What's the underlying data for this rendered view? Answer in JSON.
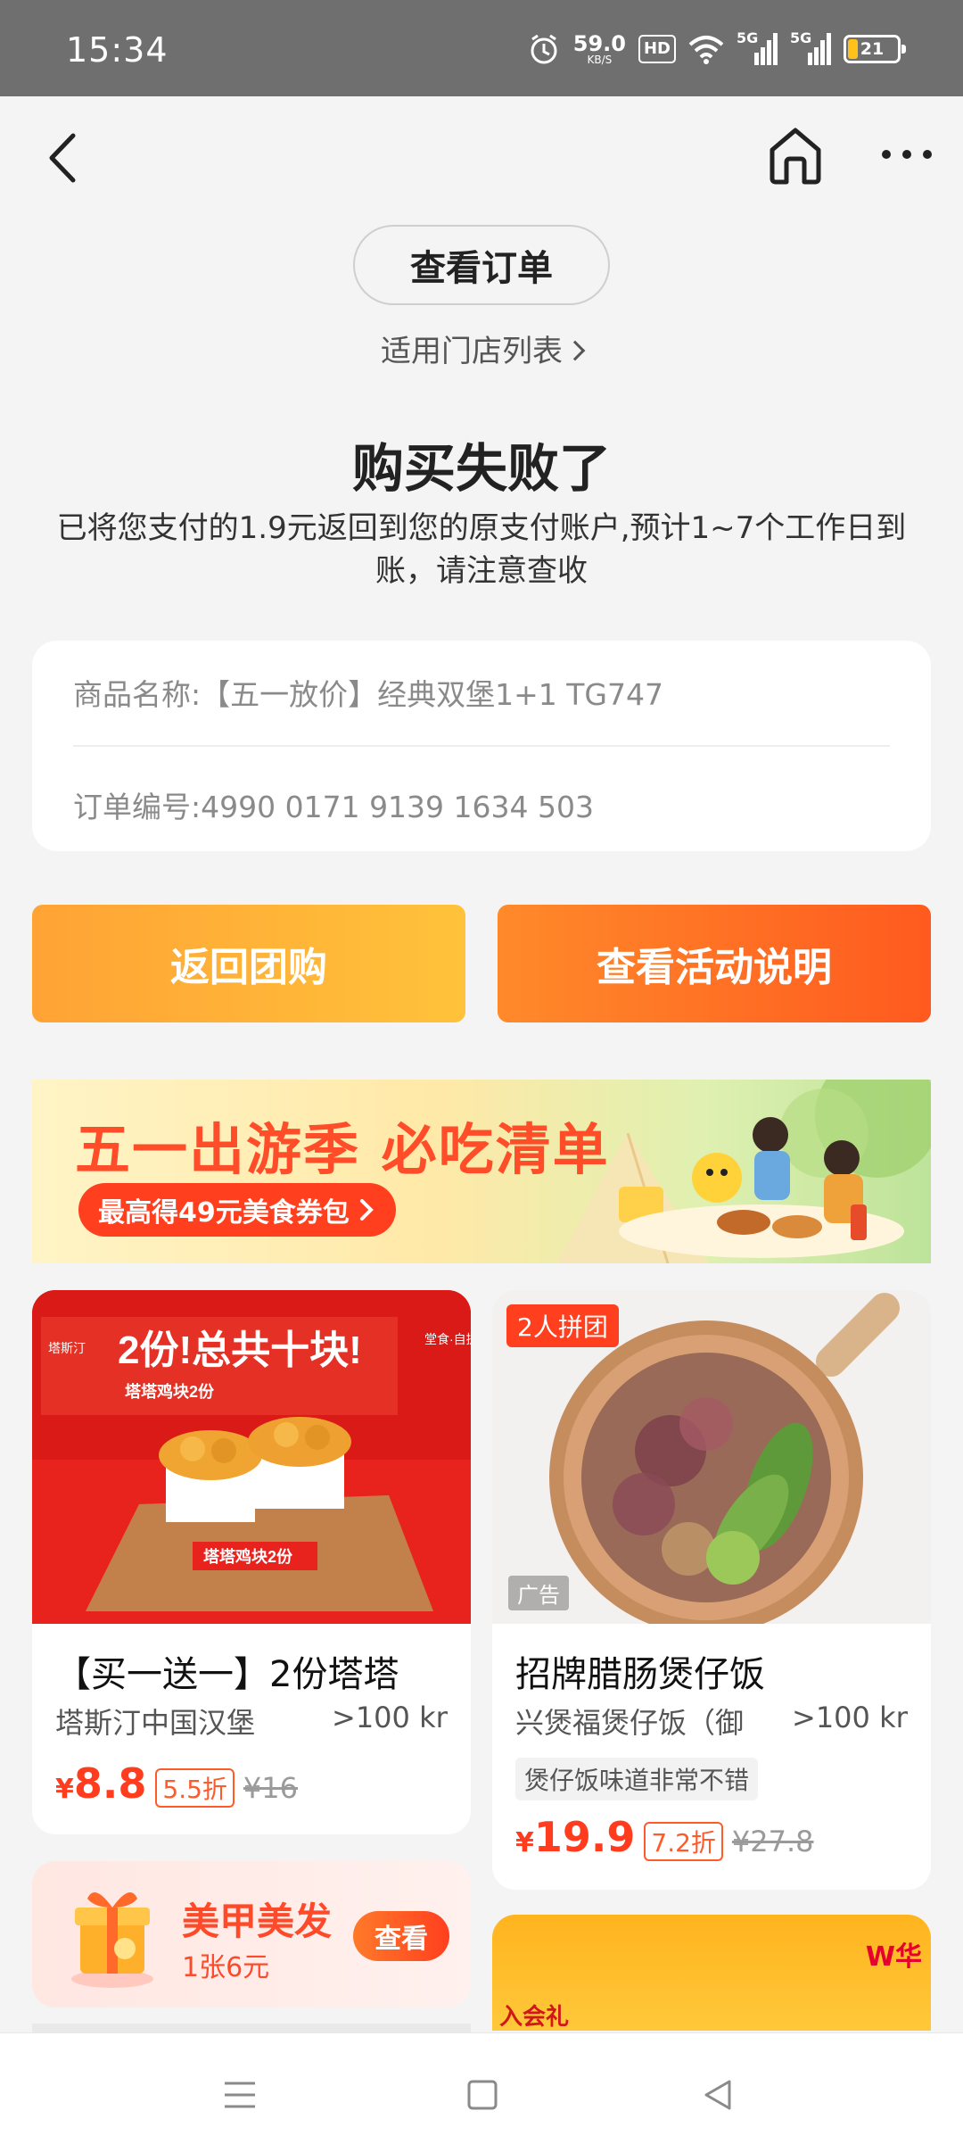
{
  "status_bar": {
    "time": "15:34",
    "net_speed_value": "59.0",
    "net_speed_unit": "KB/S",
    "hd_label": "HD",
    "signal_1_label": "5G",
    "signal_2_label": "5G",
    "battery_level": "21",
    "battery_fraction": 0.21,
    "icons": [
      "alarm-icon",
      "hd-icon",
      "wifi-icon",
      "signal-icon",
      "signal-icon",
      "battery-icon"
    ]
  },
  "nav": {
    "icons": [
      "back-icon",
      "home-icon",
      "more-icon"
    ]
  },
  "actions": {
    "view_order": "查看订单",
    "store_list": "适用门店列表"
  },
  "result": {
    "title": "购买失败了",
    "description": "已将您支付的1.9元返回到您的原支付账户,预计1~7个工作日到账，请注意查收"
  },
  "order_info": {
    "product_name": "商品名称:【五一放价】经典双堡1+1 TG747",
    "order_number": "订单编号:4990 0171 9139 1634 503"
  },
  "buttons": {
    "back_to_group": "返回团购",
    "view_activity": "查看活动说明"
  },
  "banner": {
    "title": "五一出游季 必吃清单",
    "cta": "最高得49元美食券包",
    "colors": {
      "title": "#ff4d2a",
      "pill": "#ff3f1e"
    }
  },
  "products": [
    {
      "name": "【买一送一】2份塔塔",
      "shop": "塔斯汀中国汉堡",
      "distance": ">100 km",
      "price_symbol": "¥",
      "price": "8.8",
      "discount": "5.5折",
      "original_price": "¥16",
      "image_texts": {
        "headline": "2份!总共十块!",
        "sub": "塔塔鸡块2份",
        "box": "塔塔鸡块2份",
        "brand": "塔斯汀",
        "side": "堂食·自提"
      }
    },
    {
      "name": "招牌腊肠煲仔饭",
      "shop": "兴煲福煲仔饭（御",
      "distance": ">100 km",
      "badge": "2人拼团",
      "ad_label": "广告",
      "tag": "煲仔饭味道非常不错",
      "price_symbol": "¥",
      "price": "19.9",
      "discount": "7.2折",
      "original_price": "¥27.8"
    }
  ],
  "coupon": {
    "title": "美甲美发",
    "subtitle": "1张6元",
    "button": "查看"
  },
  "promo_peek": {
    "logo": "W华",
    "tag": "入会礼"
  },
  "bottom_nav": {
    "icons": [
      "menu-icon",
      "square-icon",
      "triangle-back-icon"
    ]
  }
}
